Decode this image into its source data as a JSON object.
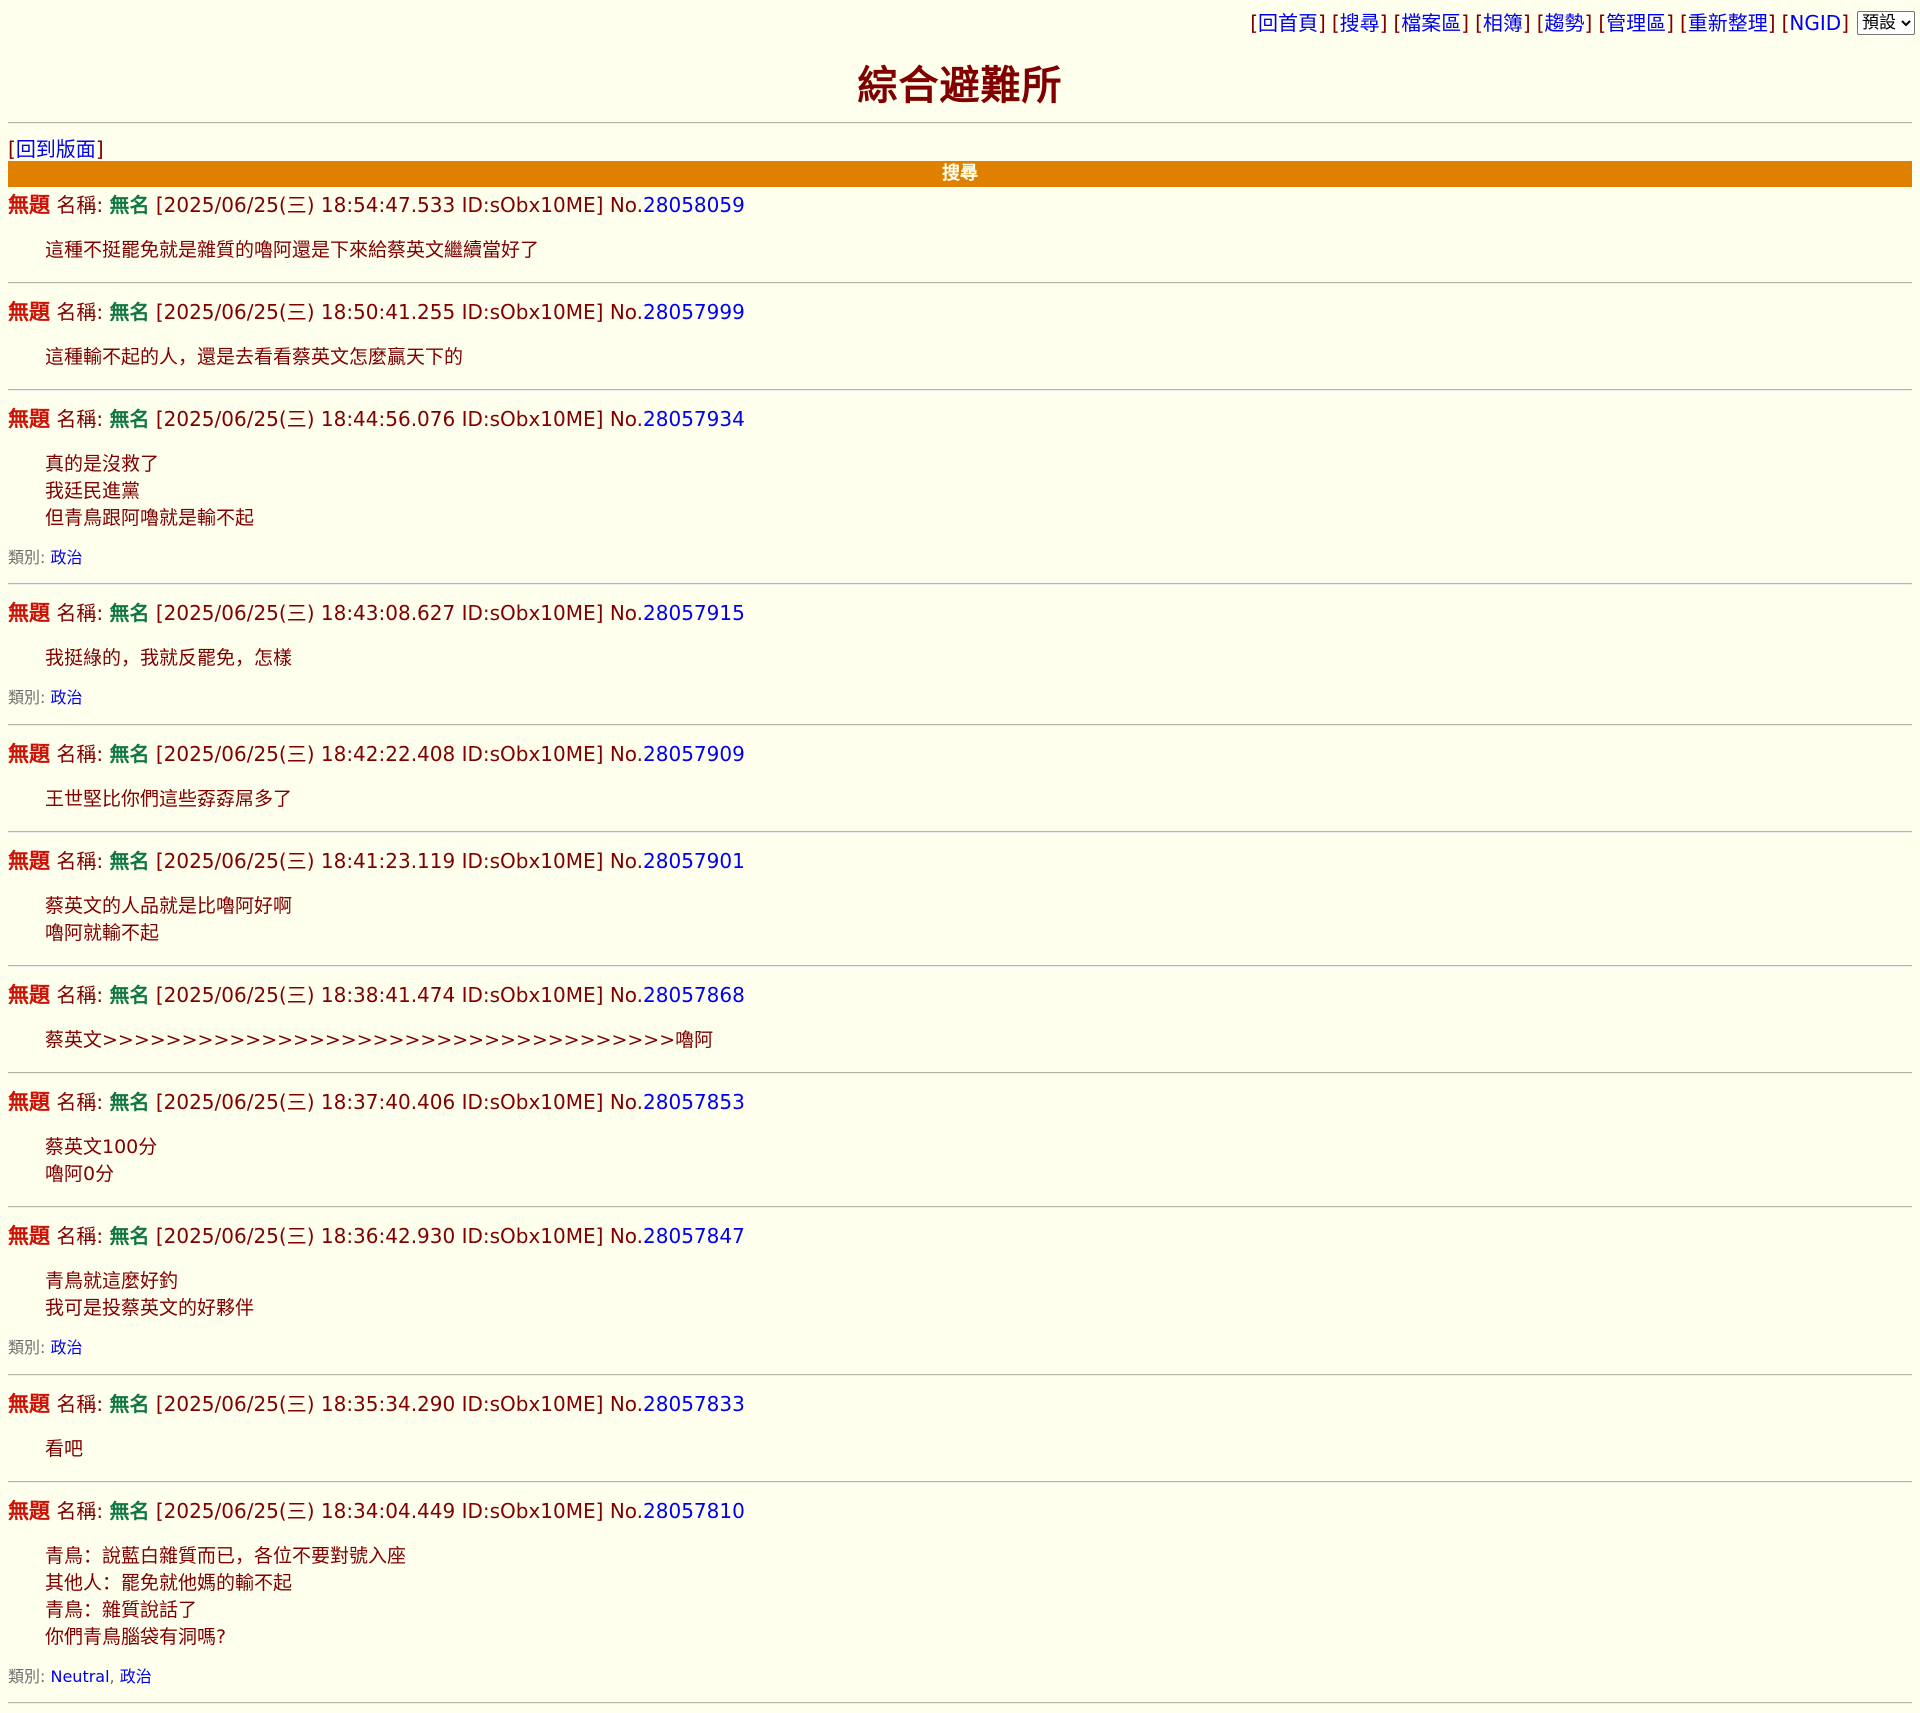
{
  "nav": {
    "links": [
      "回首頁",
      "搜尋",
      "檔案區",
      "相簿",
      "趨勢",
      "管理區",
      "重新整理",
      "NGID"
    ],
    "select_value": "預設"
  },
  "page_title": "綜合避難所",
  "back_link": "回到版面",
  "search_bar": "搜尋",
  "labels": {
    "name_prefix": "名稱: ",
    "no_prefix": "No.",
    "category_prefix": "類別: "
  },
  "posts": [
    {
      "subject": "無題",
      "name": "無名",
      "datetime": "[2025/06/25(三) 18:54:47.533 ID:sObx10ME]",
      "no": "28058059",
      "lines": [
        "這種不挺罷免就是雜質的嚕阿還是下來給蔡英文繼續當好了"
      ],
      "categories": []
    },
    {
      "subject": "無題",
      "name": "無名",
      "datetime": "[2025/06/25(三) 18:50:41.255 ID:sObx10ME]",
      "no": "28057999",
      "lines": [
        "這種輸不起的人，還是去看看蔡英文怎麼贏天下的"
      ],
      "categories": []
    },
    {
      "subject": "無題",
      "name": "無名",
      "datetime": "[2025/06/25(三) 18:44:56.076 ID:sObx10ME]",
      "no": "28057934",
      "lines": [
        "真的是沒救了",
        "我廷民進黨",
        "但青鳥跟阿嚕就是輸不起"
      ],
      "categories": [
        "政治"
      ]
    },
    {
      "subject": "無題",
      "name": "無名",
      "datetime": "[2025/06/25(三) 18:43:08.627 ID:sObx10ME]",
      "no": "28057915",
      "lines": [
        "我挺綠的，我就反罷免，怎樣"
      ],
      "categories": [
        "政治"
      ]
    },
    {
      "subject": "無題",
      "name": "無名",
      "datetime": "[2025/06/25(三) 18:42:22.408 ID:sObx10ME]",
      "no": "28057909",
      "lines": [
        "王世堅比你們這些孬孬屌多了"
      ],
      "categories": []
    },
    {
      "subject": "無題",
      "name": "無名",
      "datetime": "[2025/06/25(三) 18:41:23.119 ID:sObx10ME]",
      "no": "28057901",
      "lines": [
        "蔡英文的人品就是比嚕阿好啊",
        "嚕阿就輸不起"
      ],
      "categories": []
    },
    {
      "subject": "無題",
      "name": "無名",
      "datetime": "[2025/06/25(三) 18:38:41.474 ID:sObx10ME]",
      "no": "28057868",
      "lines": [
        "蔡英文>>>>>>>>>>>>>>>>>>>>>>>>>>>>>>>>>>>>嚕阿"
      ],
      "categories": []
    },
    {
      "subject": "無題",
      "name": "無名",
      "datetime": "[2025/06/25(三) 18:37:40.406 ID:sObx10ME]",
      "no": "28057853",
      "lines": [
        "蔡英文100分",
        "嚕阿0分"
      ],
      "categories": []
    },
    {
      "subject": "無題",
      "name": "無名",
      "datetime": "[2025/06/25(三) 18:36:42.930 ID:sObx10ME]",
      "no": "28057847",
      "lines": [
        "青鳥就這麼好釣",
        "我可是投蔡英文的好夥伴"
      ],
      "categories": [
        "政治"
      ]
    },
    {
      "subject": "無題",
      "name": "無名",
      "datetime": "[2025/06/25(三) 18:35:34.290 ID:sObx10ME]",
      "no": "28057833",
      "lines": [
        "看吧"
      ],
      "categories": []
    },
    {
      "subject": "無題",
      "name": "無名",
      "datetime": "[2025/06/25(三) 18:34:04.449 ID:sObx10ME]",
      "no": "28057810",
      "lines": [
        "青鳥：說藍白雜質而已，各位不要對號入座",
        "其他人：罷免就他媽的輸不起",
        "青鳥：雜質說話了",
        "你們青鳥腦袋有洞嗎?"
      ],
      "categories": [
        "Neutral",
        "政治"
      ]
    }
  ]
}
